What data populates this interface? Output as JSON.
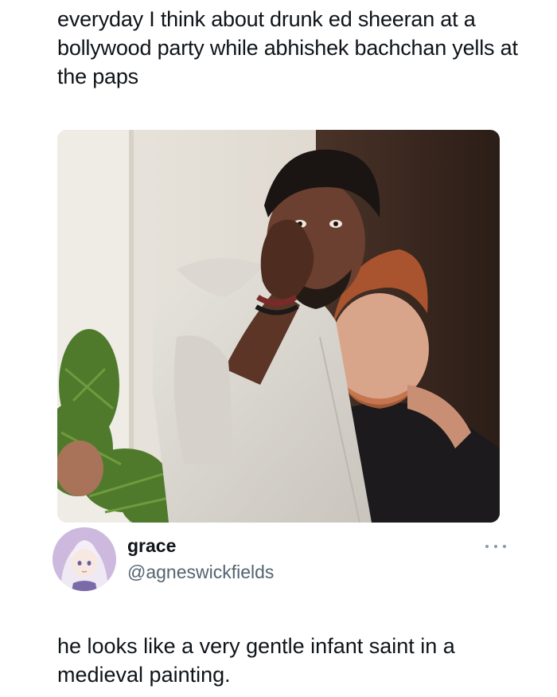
{
  "caption": {
    "text": "everyday I think about drunk ed sheeran at a bollywood party while abhishek bachchan yells at the paps"
  },
  "photo": {
    "icon": "photo-image"
  },
  "tweet": {
    "display_name": "grace",
    "handle": "@agneswickfields",
    "avatar_icon": "anime-avatar-icon",
    "more_icon": "more-options-icon",
    "text": "he looks like a very gentle infant saint in a medieval painting."
  }
}
